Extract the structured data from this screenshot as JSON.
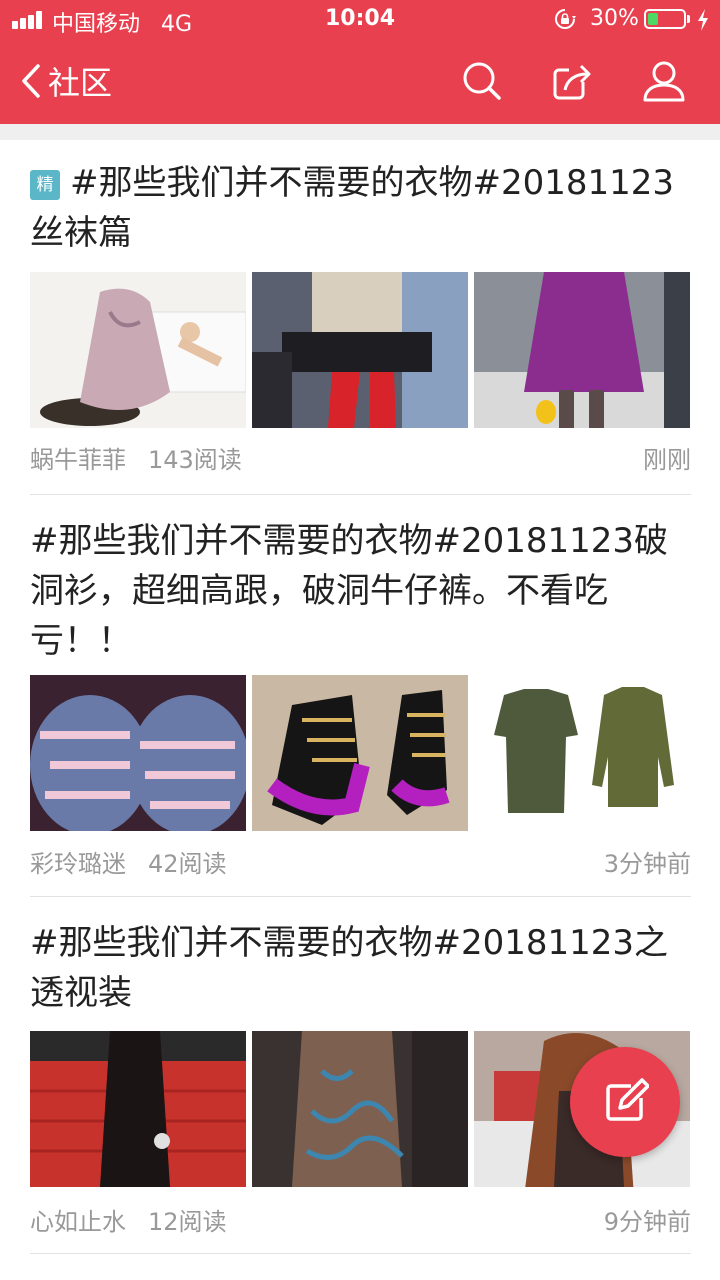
{
  "status_bar": {
    "carrier": "中国移动",
    "network": "4G",
    "time": "10:04",
    "battery_percent": "30%",
    "battery_level": 0.3
  },
  "nav": {
    "back_label": "社区",
    "icons": [
      "search-icon",
      "share-icon",
      "user-icon"
    ],
    "accent_color": "#e8404f"
  },
  "posts": [
    {
      "badge": "精",
      "title": "#那些我们并不需要的衣物#20181123丝袜篇",
      "author": "蜗牛菲菲",
      "reads": "143阅读",
      "time": "刚刚",
      "images": [
        "photo-floral-dress-black-stockings",
        "photo-red-tights-chair",
        "photo-purple-dress-patterned-stockings"
      ]
    },
    {
      "title": "#那些我们并不需要的衣物#20181123破洞衫，超细高跟，破洞牛仔裤。不看吃亏！！",
      "author": "彩玲璐迷",
      "reads": "42阅读",
      "time": "3分钟前",
      "images": [
        "photo-ripped-jeans",
        "photo-purple-high-heels",
        "photo-olive-ripped-shirts"
      ]
    },
    {
      "title": "#那些我们并不需要的衣物#20181123之透视装",
      "author": "心如止水",
      "reads": "12阅读",
      "time": "9分钟前",
      "images": [
        "photo-black-lace-gown-red-carpet",
        "photo-sheer-embroidered-dress",
        "photo-sheer-top-red-hair"
      ]
    }
  ],
  "fab": {
    "icon": "compose-icon"
  }
}
